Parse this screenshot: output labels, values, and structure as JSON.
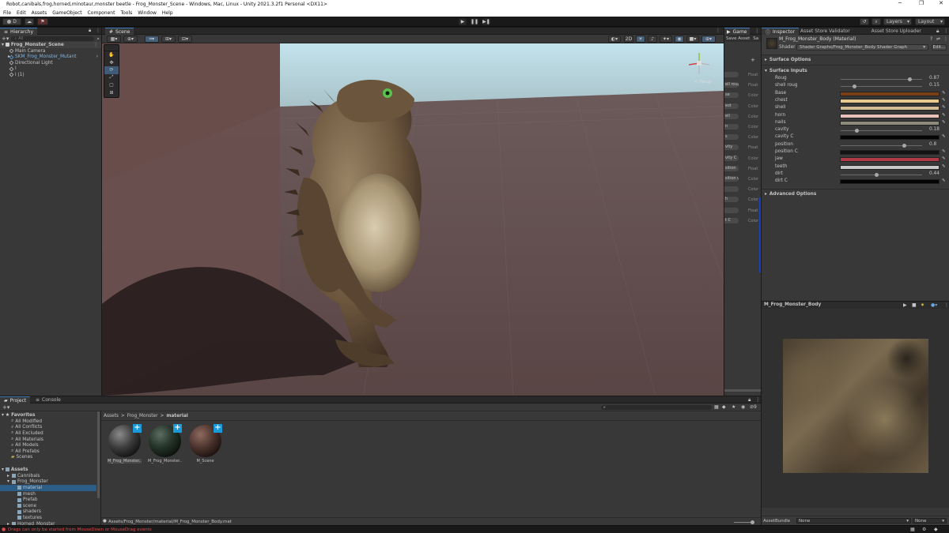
{
  "window": {
    "title": "Robot,canibals,frog,horned,minotaur,monster beetle - Frog_Monster_Scene - Windows, Mac, Linux - Unity 2021.3.2f1 Personal <DX11>",
    "minimize": "─",
    "maximize": "❐",
    "close": "✕"
  },
  "menu": [
    "File",
    "Edit",
    "Assets",
    "GameObject",
    "Component",
    "Tools",
    "Window",
    "Help"
  ],
  "toolbar": {
    "account": "D",
    "layers_label": "Layers",
    "layout_label": "Layout"
  },
  "hierarchy": {
    "tab": "Hierarchy",
    "search_placeholder": "All",
    "scene_name": "Frog_Monster_Scene",
    "items": [
      {
        "label": "Main Camera",
        "indent": 1,
        "prefab": false
      },
      {
        "label": "SKM_Frog_Monster_Mutant",
        "indent": 1,
        "prefab": true
      },
      {
        "label": "Directional Light",
        "indent": 1,
        "prefab": false
      },
      {
        "label": "l",
        "indent": 1,
        "prefab": false
      },
      {
        "label": "l (1)",
        "indent": 1,
        "prefab": false
      }
    ]
  },
  "scene": {
    "tab": "Scene",
    "gizmo_label": "< Persp"
  },
  "game": {
    "tab": "Game",
    "save_asset": "Save Asset",
    "side_tab": "Sa",
    "items": [
      {
        "a": "",
        "b": "Float"
      },
      {
        "a": "ell roug",
        "b": "Float"
      },
      {
        "a": "se",
        "b": "Color"
      },
      {
        "a": "est",
        "b": "Color"
      },
      {
        "a": "ell",
        "b": "Color"
      },
      {
        "a": "n",
        "b": "Color"
      },
      {
        "a": "s",
        "b": "Color"
      },
      {
        "a": "vity",
        "b": "Float"
      },
      {
        "a": "vity C",
        "b": "Color"
      },
      {
        "a": "sition",
        "b": "Float"
      },
      {
        "a": "sition C",
        "b": "Color"
      },
      {
        "a": "",
        "b": "Color"
      },
      {
        "a": "h",
        "b": "Color"
      },
      {
        "a": "",
        "b": "Float"
      },
      {
        "a": "t C",
        "b": "Color"
      }
    ]
  },
  "inspector": {
    "tabs": [
      "Inspector",
      "Asset Store Validator",
      "Asset Store Uploader"
    ],
    "material_name": "M_Frog_Monster_Body (Material)",
    "shader_label": "Shader",
    "shader_value": "Shader Graphs/Frog_Monster_Body Shader Graph",
    "edit_label": "Edit...",
    "surface_options": "Surface Options",
    "surface_inputs": "Surface Inputs",
    "advanced_options": "Advanced Options",
    "properties": [
      {
        "label": "Roug",
        "type": "slider",
        "value": "0.87",
        "fraction": 0.87
      },
      {
        "label": "shell roug",
        "type": "slider",
        "value": "0.15",
        "fraction": 0.15
      },
      {
        "label": "Base",
        "type": "color",
        "color": "#7a3f14"
      },
      {
        "label": "chest",
        "type": "color",
        "color": "#e7c98f"
      },
      {
        "label": "shell",
        "type": "color",
        "color": "#d2bd96"
      },
      {
        "label": "horn",
        "type": "color",
        "color": "#e8c2b8"
      },
      {
        "label": "nails",
        "type": "color",
        "color": "#8c8a78"
      },
      {
        "label": "cavity",
        "type": "slider",
        "value": "0.18",
        "fraction": 0.18
      },
      {
        "label": "cavity C",
        "type": "color",
        "color": "#050505"
      },
      {
        "label": "position",
        "type": "slider",
        "value": "0.8",
        "fraction": 0.8
      },
      {
        "label": "position C",
        "type": "color",
        "color": "#131313"
      },
      {
        "label": "jaw",
        "type": "color",
        "color": "#b03a45"
      },
      {
        "label": "teeth",
        "type": "color",
        "color": "#c9c9c9"
      },
      {
        "label": "dirt",
        "type": "slider",
        "value": "0.44",
        "fraction": 0.44
      },
      {
        "label": "dirt C",
        "type": "color",
        "color": "#050505"
      }
    ],
    "preview_title": "M_Frog_Monster_Body",
    "asset_bundle_label": "AssetBundle",
    "asset_bundle_value": "None",
    "asset_variant_value": "None"
  },
  "project": {
    "tabs": [
      "Project",
      "Console"
    ],
    "breadcrumb": [
      "Assets",
      "Frog_Monster",
      "material"
    ],
    "favorites_label": "Favorites",
    "favorites": [
      "All Modified",
      "All Conflicts",
      "All Excluded",
      "All Materials",
      "All Models",
      "All Prefabs",
      "Scenes"
    ],
    "assets_label": "Assets",
    "tree": [
      {
        "label": "Cannibals",
        "indent": 1,
        "selected": false
      },
      {
        "label": "Frog_Monster",
        "indent": 1,
        "selected": false
      },
      {
        "label": "material",
        "indent": 2,
        "selected": true
      },
      {
        "label": "mesh",
        "indent": 2,
        "selected": false
      },
      {
        "label": "Prefab",
        "indent": 2,
        "selected": false
      },
      {
        "label": "scene",
        "indent": 2,
        "selected": false
      },
      {
        "label": "shaders",
        "indent": 2,
        "selected": false
      },
      {
        "label": "textures",
        "indent": 2,
        "selected": false
      },
      {
        "label": "Horned_Monster",
        "indent": 1,
        "selected": false
      }
    ],
    "materials": [
      {
        "label": "M_Frog_Monster...",
        "ball": "radial-gradient(circle at 35% 30%, #8a8a8a 0%, #3a3a3a 45%, #111 80%)"
      },
      {
        "label": "M_Frog_Monster...",
        "ball": "radial-gradient(circle at 35% 30%, #5d6d60 0%, #27362b 40%, #0a0f0b 80%)"
      },
      {
        "label": "M_Scene",
        "ball": "radial-gradient(circle at 35% 30%, #8e6a60 0%, #4a322c 45%, #1a100d 80%)"
      }
    ],
    "path": "Assets/Frog_Monster/material/M_Frog_Monster_Body.mat",
    "count": "9"
  },
  "status": {
    "message": "Drags can only be started from MouseDown or MouseDrag events"
  }
}
